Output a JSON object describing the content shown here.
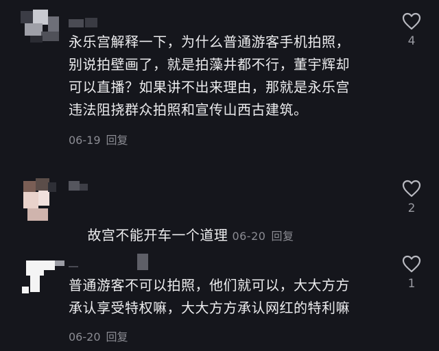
{
  "comments": [
    {
      "text": "永乐宫解释一下，为什么普通游客手机拍照，\n别说拍壁画了，就是拍藻井都不行，董宇辉却\n可以直播？如果讲不出来理由，那就是永乐宫\n违法阻挠群众拍照和宣传山西古建筑。",
      "date": "06-19",
      "reply_label": "回复",
      "likes": "4"
    },
    {
      "text": "故宫不能开车一个道理",
      "date": "06-20",
      "reply_label": "回复",
      "likes": "2"
    },
    {
      "text": "普通游客不可以拍照，他们就可以，大大方方\n承认享受特权嘛，大大方方承认网红的特利嘛",
      "date": "06-20",
      "reply_label": "回复",
      "likes": "1"
    }
  ],
  "icons": {
    "like": "heart-outline-icon"
  },
  "colors": {
    "background": "#15161c",
    "text": "#ececee",
    "meta": "#8b8c93"
  }
}
